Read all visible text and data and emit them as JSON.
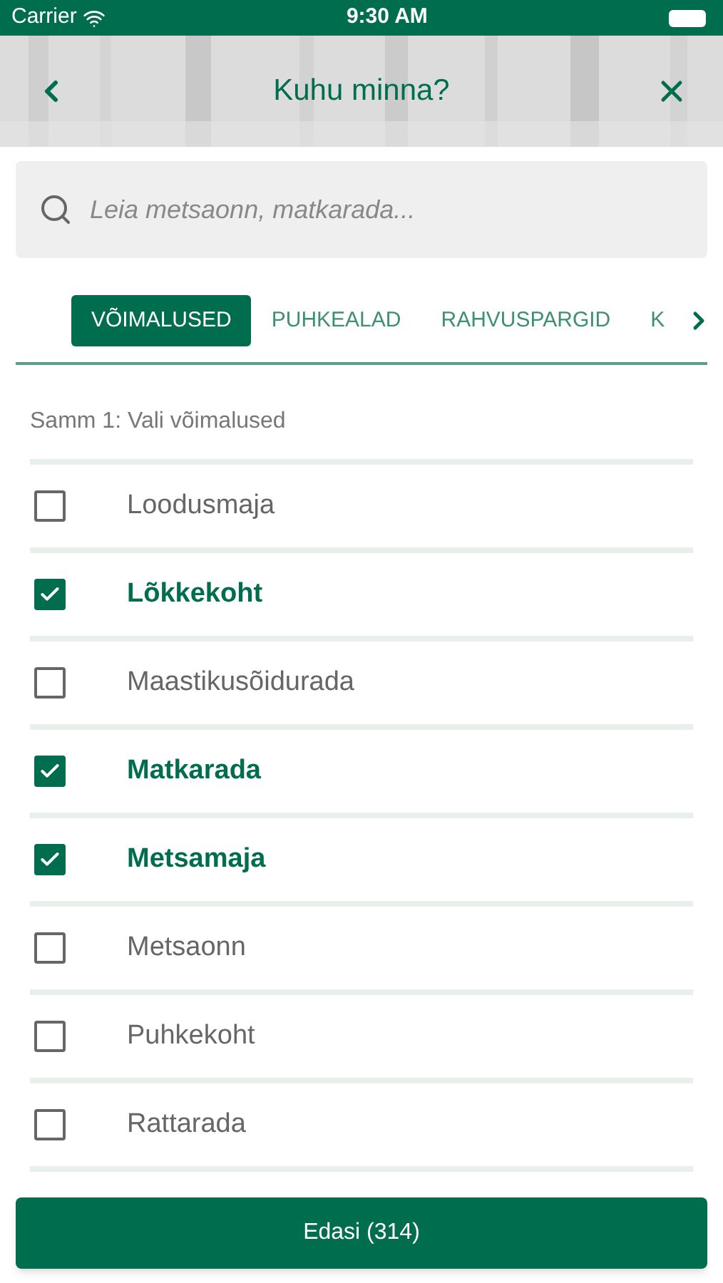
{
  "status_bar": {
    "carrier": "Carrier",
    "time": "9:30 AM"
  },
  "header": {
    "title": "Kuhu minna?"
  },
  "search": {
    "placeholder": "Leia metsaonn, matkarada..."
  },
  "tabs": [
    {
      "label": "VÕIMALUSED",
      "selected": true
    },
    {
      "label": "PUHKEALAD",
      "selected": false
    },
    {
      "label": "RAHVUSPARGID",
      "selected": false
    },
    {
      "label": "K",
      "selected": false
    }
  ],
  "step": "Samm 1: Vali võimalused",
  "options": [
    {
      "label": "Loodusmaja",
      "checked": false
    },
    {
      "label": "Lõkkekoht",
      "checked": true
    },
    {
      "label": "Maastikusõidurada",
      "checked": false
    },
    {
      "label": "Matkarada",
      "checked": true
    },
    {
      "label": "Metsamaja",
      "checked": true
    },
    {
      "label": "Metsaonn",
      "checked": false
    },
    {
      "label": "Puhkekoht",
      "checked": false
    },
    {
      "label": "Rattarada",
      "checked": false
    }
  ],
  "next_button": "Edasi (314)"
}
